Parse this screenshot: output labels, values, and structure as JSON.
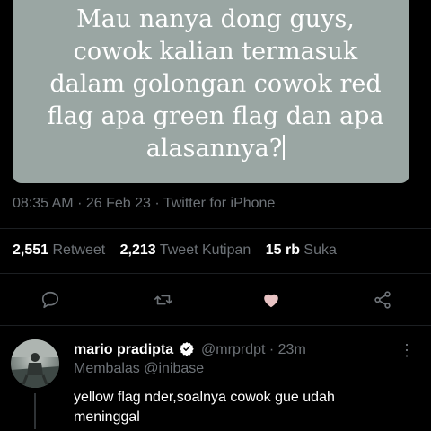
{
  "quote": {
    "text": "Mau nanya dong guys,\ncowok kalian termasuk\ndalam golongan cowok red\nflag apa green flag dan apa\nalasannya?"
  },
  "tweet_meta": {
    "time": "08:35 AM",
    "date": "26 Feb 23",
    "source": "Twitter for iPhone",
    "separator": "·"
  },
  "stats": {
    "retweets_count": "2,551",
    "retweets_label": "Retweet",
    "quotes_count": "2,213",
    "quotes_label": "Tweet Kutipan",
    "likes_count": "15 rb",
    "likes_label": "Suka"
  },
  "actions": {
    "reply_icon": "comment-icon",
    "retweet_icon": "retweet-icon",
    "like_icon": "heart-icon",
    "share_icon": "share-icon",
    "like_color": "#e8c3c4",
    "icon_color": "#6e7378"
  },
  "reply": {
    "name": "mario pradipta",
    "handle": "@mrprdpt",
    "time": "23m",
    "separator": "·",
    "replying_to": "Membalas @inibase",
    "text": "yellow flag nder,soalnya cowok gue udah meninggal",
    "verified_color": "#ffffff"
  }
}
